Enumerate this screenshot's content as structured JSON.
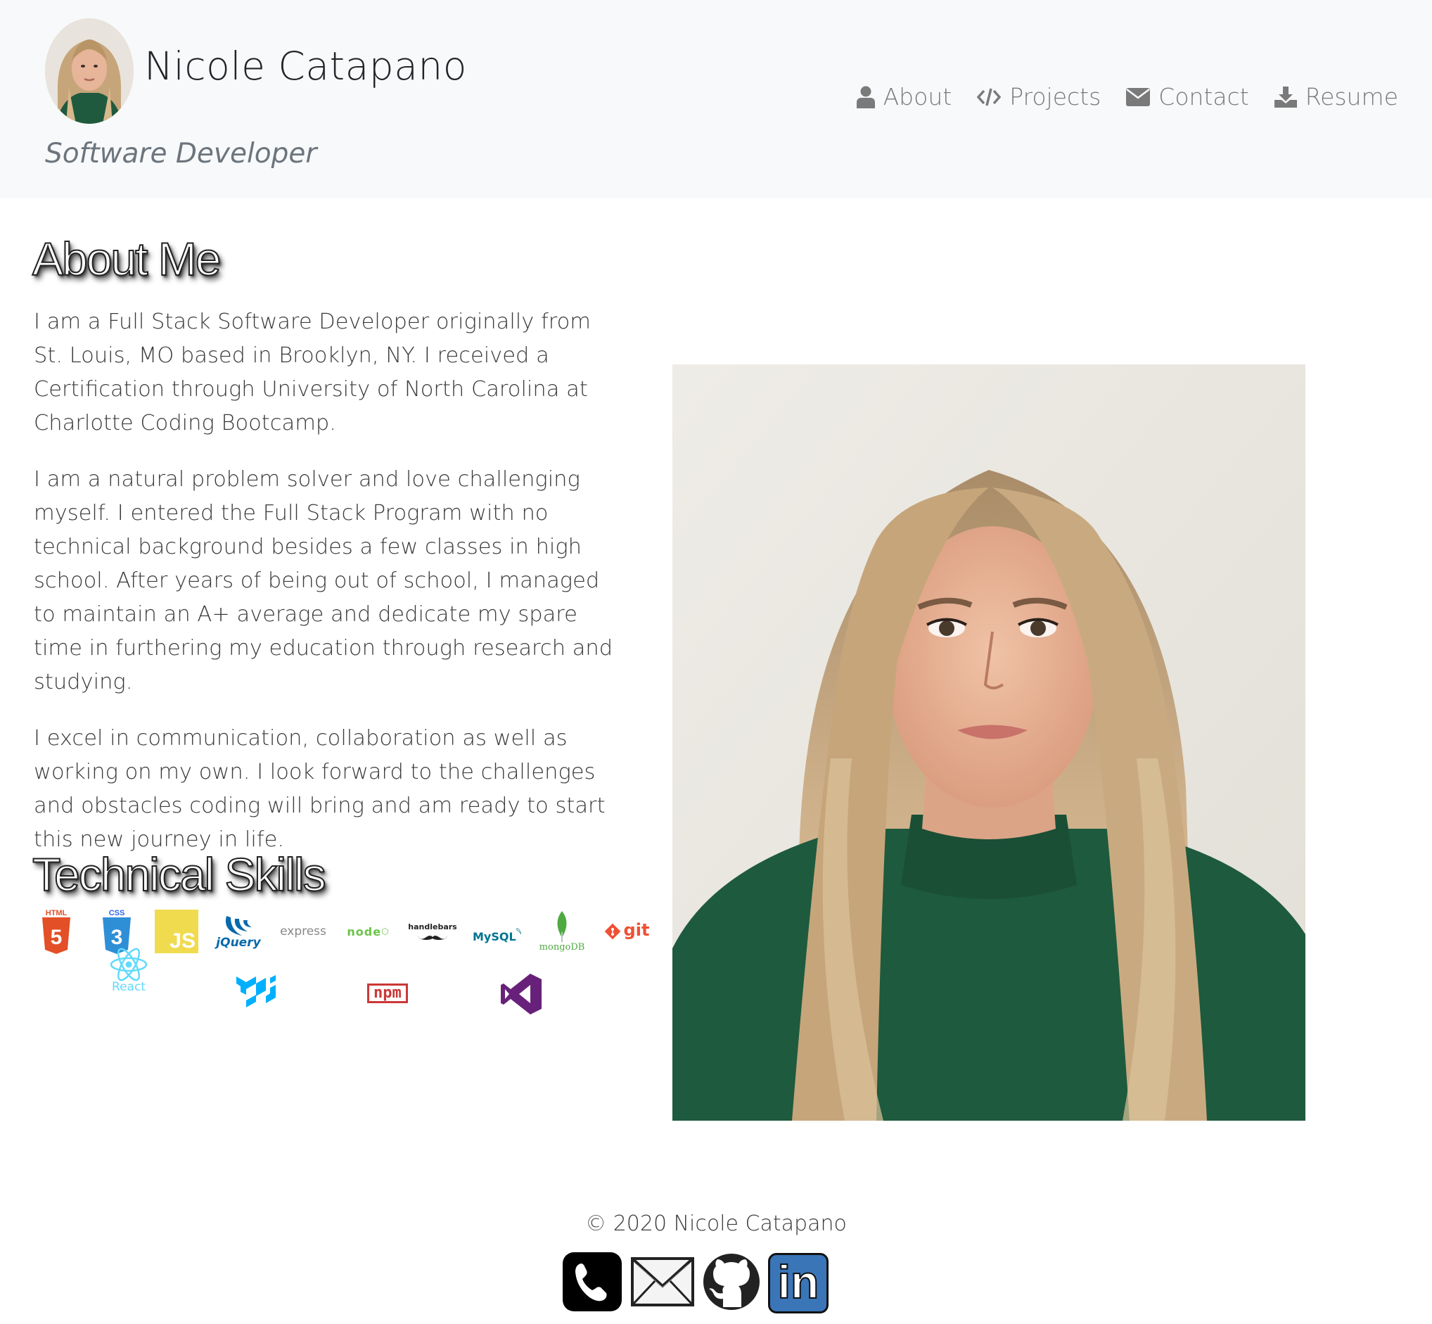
{
  "header": {
    "name": "Nicole Catapano",
    "tagline": "Software Developer",
    "nav": [
      {
        "label": "About",
        "icon": "user-icon"
      },
      {
        "label": "Projects",
        "icon": "code-icon"
      },
      {
        "label": "Contact",
        "icon": "envelope-icon"
      },
      {
        "label": "Resume",
        "icon": "download-icon"
      }
    ]
  },
  "about": {
    "title": "About Me",
    "paragraphs": [
      "I am a Full Stack Software Developer originally from St. Louis, MO based in Brooklyn, NY. I received a Certification through University of North Carolina at Charlotte Coding Bootcamp.",
      "I am a natural problem solver and love challenging myself. I entered the Full Stack Program with no technical background besides a few classes in high school. After years of being out of school, I managed to maintain an A+ average and dedicate my spare time in furthering my education through research and studying.",
      "I excel in communication, collaboration as well as working on my own. I look forward to the challenges and obstacles coding will bring and am ready to start this new journey in life."
    ]
  },
  "skills": {
    "title": "Technical Skills",
    "logos": {
      "html": "HTML",
      "css": "CSS",
      "js": "JS",
      "jquery": "jQuery",
      "express": "express",
      "node": "node",
      "handlebars": "handlebars",
      "mysql": "MySQL",
      "mongodb": "mongoDB",
      "git": "git",
      "react": "React",
      "npm": "npm"
    }
  },
  "footer": {
    "copyright": "© 2020 Nicole Catapano",
    "linkedin": "in"
  },
  "colors": {
    "header_bg": "#f8f9fa",
    "nav_text": "#7a7a7a",
    "sweater": "#1f5a3e",
    "hair": "#c9a87a"
  }
}
